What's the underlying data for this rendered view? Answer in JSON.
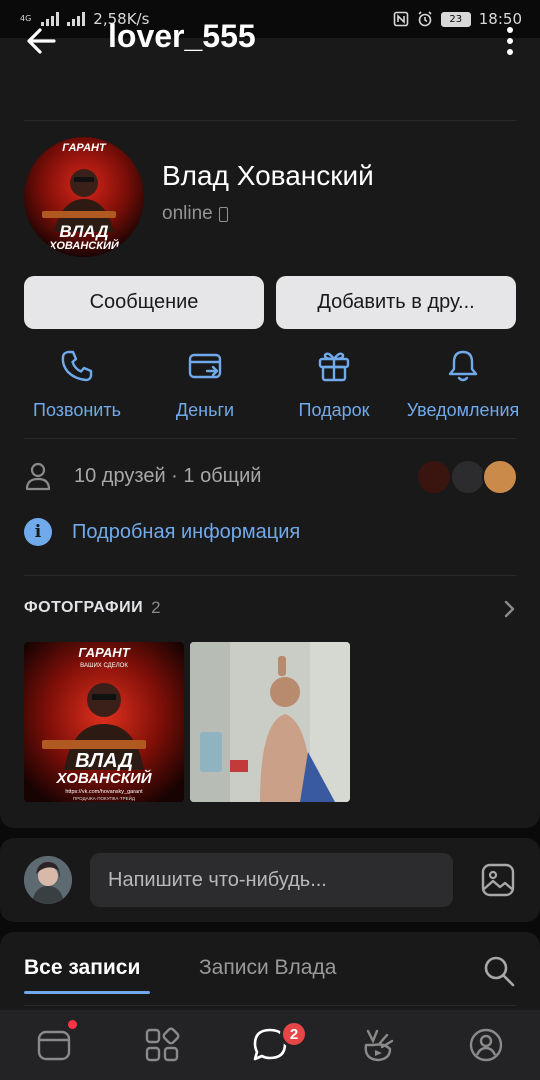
{
  "status_bar": {
    "network": "4G",
    "speed": "2,58K/s",
    "battery": "23",
    "time": "18:50"
  },
  "header": {
    "title": "lover_555"
  },
  "profile": {
    "name": "Влад Хованский",
    "status": "online",
    "avatar_text": "ГАРАНТ ВАШИХ СДЕЛОК ВЛАД ХОВАНСКИЙ"
  },
  "buttons": {
    "message": "Сообщение",
    "add_friend": "Добавить в дру..."
  },
  "actions": [
    {
      "label": "Позвонить",
      "icon": "phone-icon"
    },
    {
      "label": "Деньги",
      "icon": "money-transfer-icon"
    },
    {
      "label": "Подарок",
      "icon": "gift-icon"
    },
    {
      "label": "Уведомления",
      "icon": "bell-icon"
    }
  ],
  "friends": {
    "text": "10 друзей · 1 общий"
  },
  "details": {
    "label": "Подробная информация"
  },
  "photos": {
    "title": "ФОТОГРАФИИ",
    "count": "2",
    "items": [
      {
        "caption": "ГАРАНТ",
        "sub": "ВАШИХ СДЕЛОК",
        "name_line1": "ВЛАД",
        "name_line2": "ХОВАНСКИЙ",
        "url": "https://vk.com/hovansky_garant",
        "foot": "ПРОДАЖА·ПОКУПКА·ТРЕЙД"
      },
      {
        "caption": ""
      }
    ]
  },
  "compose": {
    "placeholder": "Напишите что-нибудь..."
  },
  "wall_tabs": {
    "all": "Все записи",
    "own": "Записи Влада"
  },
  "bottom_nav": {
    "items": [
      "feed-icon",
      "services-icon",
      "messages-icon",
      "clips-icon",
      "profile-icon"
    ],
    "messages_badge": "2"
  },
  "colors": {
    "accent": "#71aaeb",
    "card": "#19191a",
    "background": "#0a0a0a",
    "badge": "#e64646"
  }
}
